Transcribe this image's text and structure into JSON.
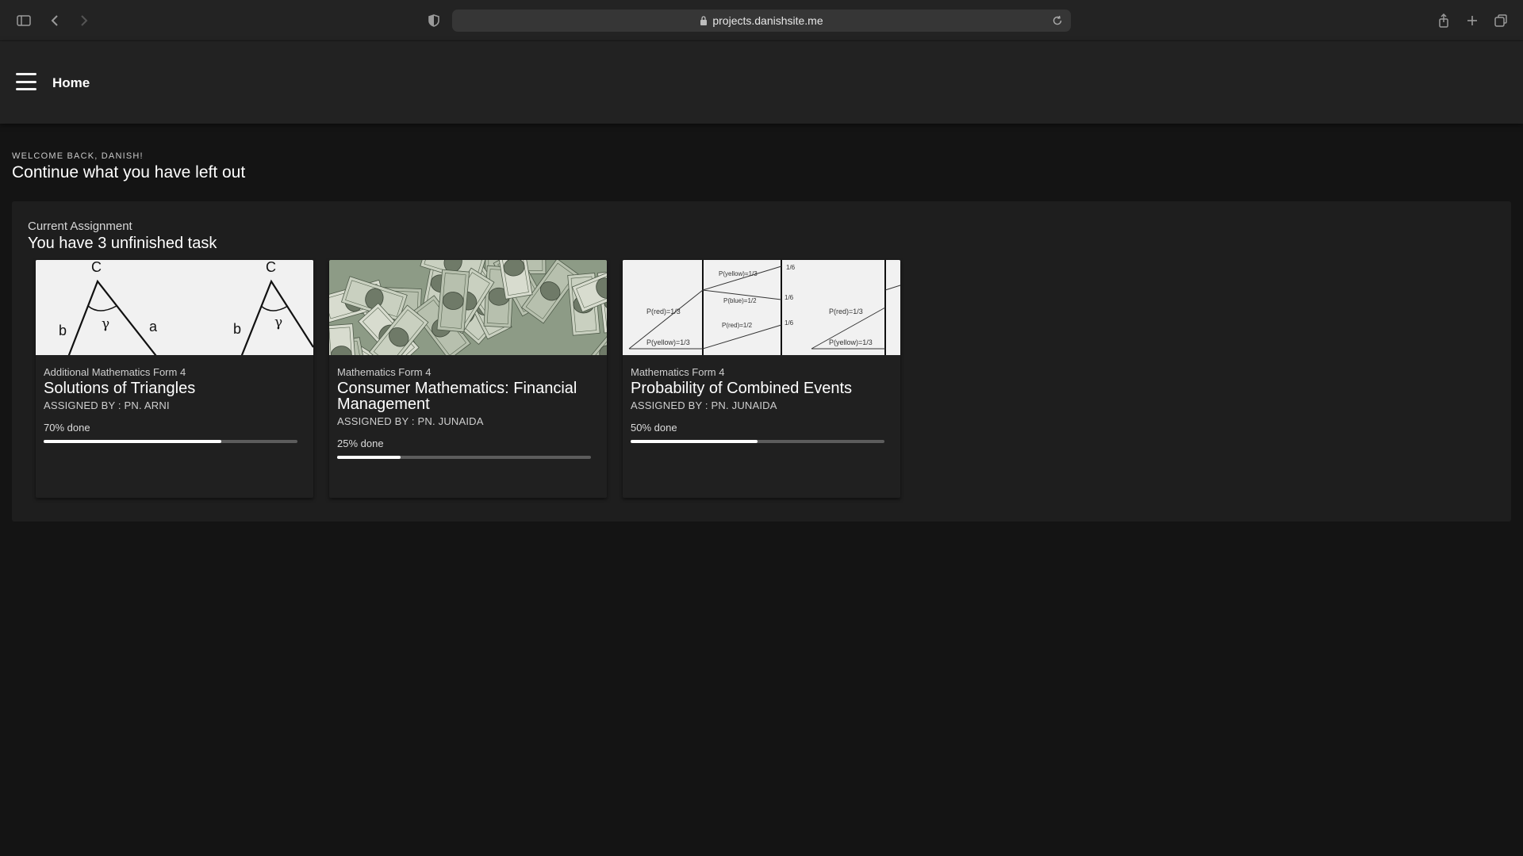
{
  "browser": {
    "url": "projects.danishsite.me"
  },
  "header": {
    "title": "Home"
  },
  "welcome": {
    "kicker": "WELCOME BACK, DANISH!",
    "heading": "Continue what you have left out"
  },
  "assignments": {
    "kicker": "Current Assignment",
    "heading": "You have 3 unfinished task",
    "cards": [
      {
        "subject": "Additional Mathematics Form 4",
        "title": "Solutions of Triangles",
        "assigned": "ASSIGNED BY : PN. ARNI",
        "progress_label": "70% done",
        "progress": 0.7,
        "image_icon": "triangle-diagram"
      },
      {
        "subject": "Mathematics Form 4",
        "title": "Consumer Mathematics: Financial Management",
        "assigned": "ASSIGNED BY : PN. JUNAIDA",
        "progress_label": "25% done",
        "progress": 0.25,
        "image_icon": "money-photo"
      },
      {
        "subject": "Mathematics Form 4",
        "title": "Probability of Combined Events",
        "assigned": "ASSIGNED BY : PN. JUNAIDA",
        "progress_label": "50% done",
        "progress": 0.5,
        "image_icon": "tree-diagram"
      }
    ]
  },
  "triangle_image": {
    "label_c": "C",
    "label_a": "a",
    "label_b": "b",
    "label_gamma": "γ"
  },
  "tree_image": {
    "labels": [
      "P(yellow)=1/3",
      "P(red)=1/3",
      "P(yellow)=1/3",
      "P(red)=1/3",
      "P(blue)=1/2",
      "P(red)=1/2",
      "P(yellow)=1/3",
      "1/6",
      "1/6",
      "1/6"
    ]
  },
  "colors": {
    "background": "#141414",
    "header": "#222222",
    "panel": "#1e1e1e",
    "progress_fill": "#ffffff",
    "progress_track": "#5c5c5c"
  }
}
